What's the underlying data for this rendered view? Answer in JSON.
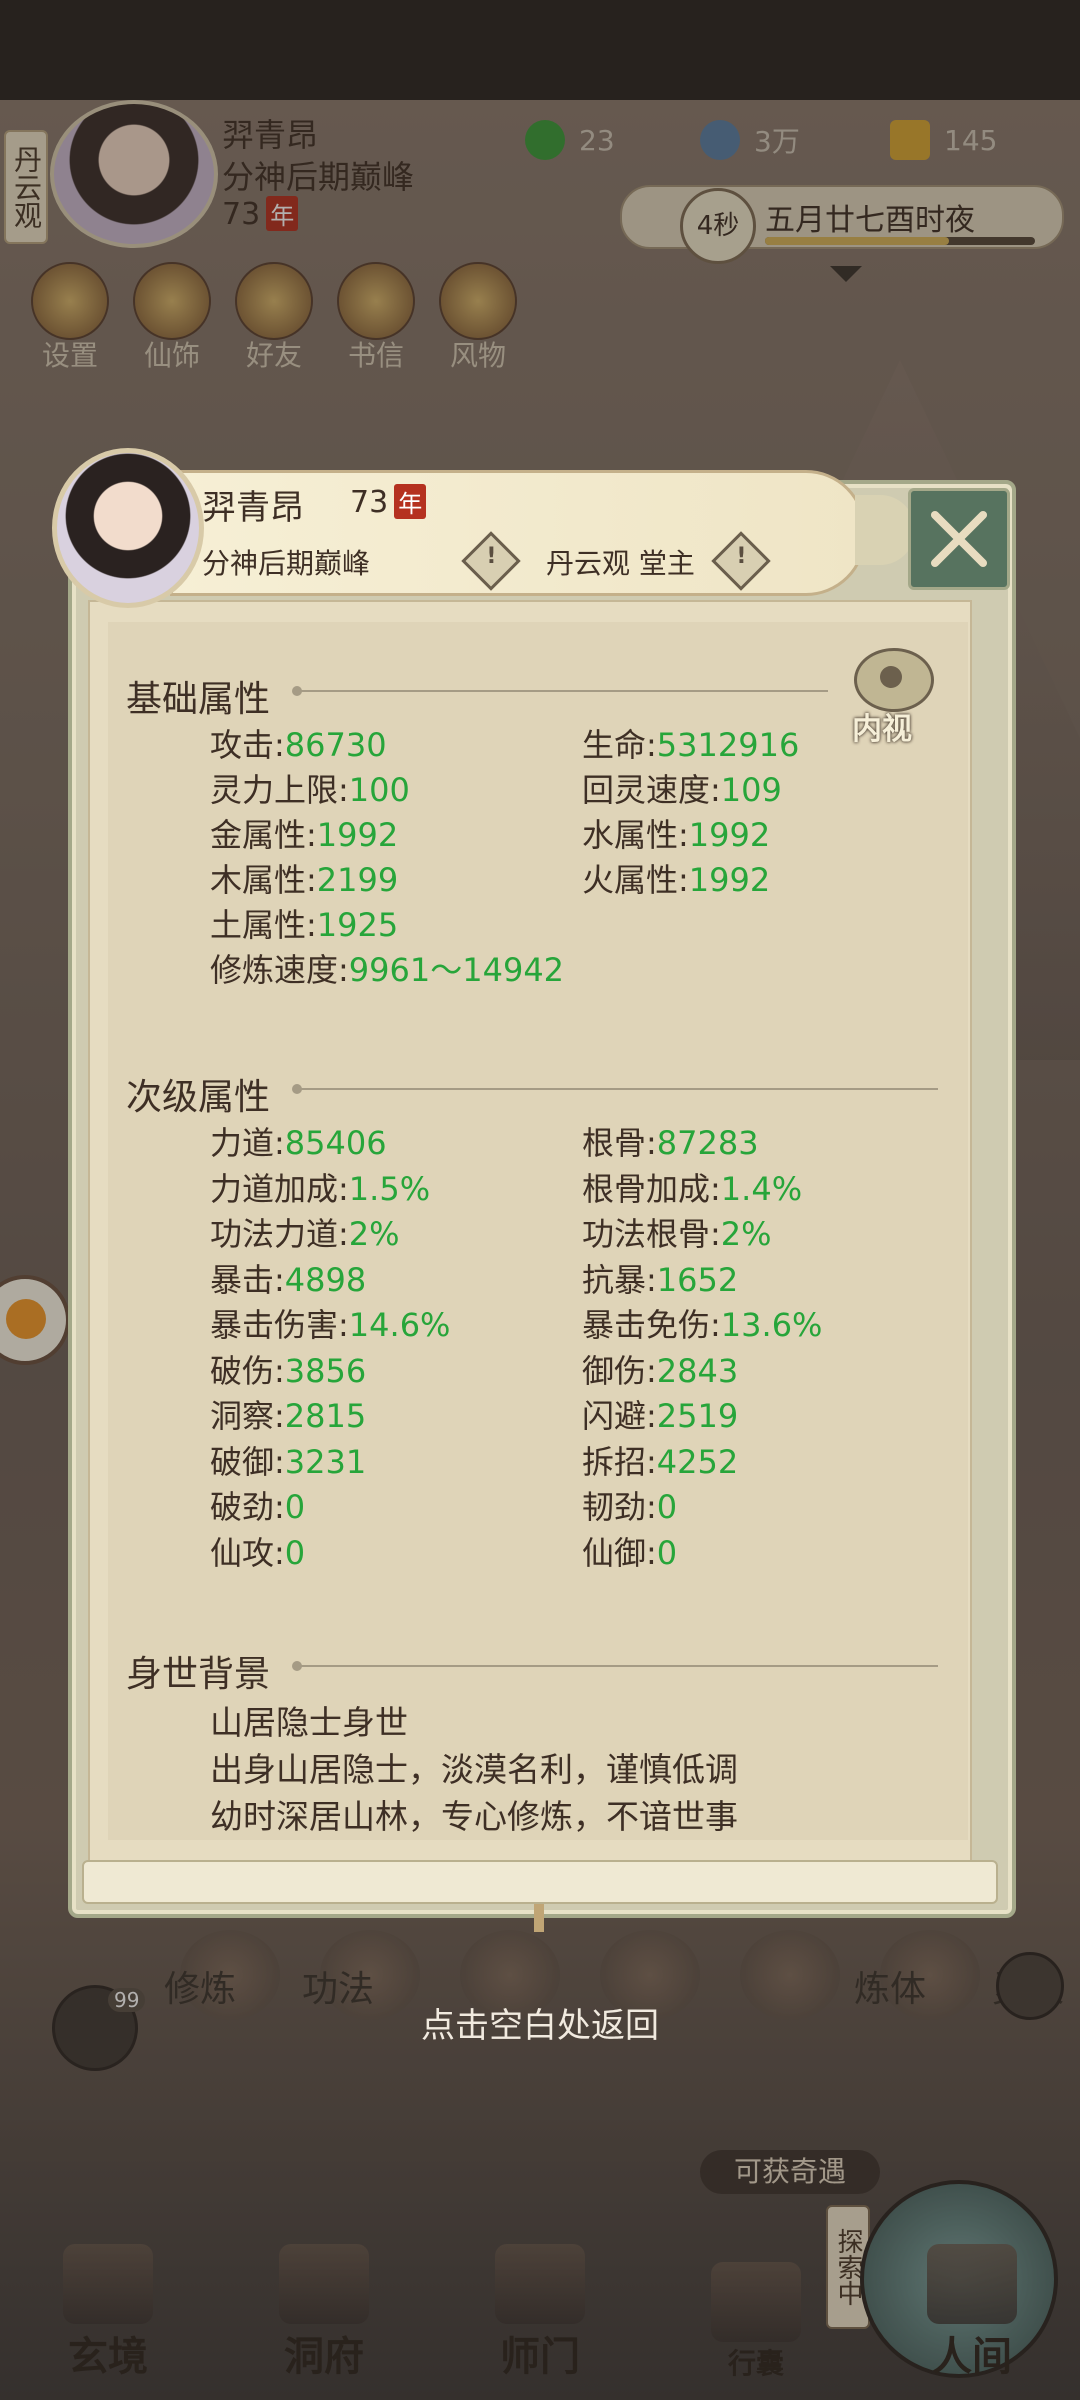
{
  "top": {
    "vertical_tag": "丹云观",
    "name": "羿青昂",
    "realm": "分神后期巅峰",
    "age": "73",
    "age_seal": "年",
    "resources": [
      {
        "icon": "leaf-icon",
        "value": "23"
      },
      {
        "icon": "coin-icon",
        "value": "3万"
      },
      {
        "icon": "gold-figure-icon",
        "value": "145"
      }
    ],
    "timer": "4秒",
    "date_text": "五月廿七酉时夜",
    "time_progress": 0.68,
    "quick": [
      "设置",
      "仙饰",
      "好友",
      "书信",
      "风物"
    ]
  },
  "panel": {
    "name": "羿青昂",
    "age": "73",
    "age_seal": "年",
    "realm": "分神后期巅峰",
    "sect": "丹云观 堂主",
    "eye_label": "内视",
    "basic_title": "基础属性",
    "basic": [
      {
        "label": "攻击",
        "value": "86730"
      },
      {
        "label": "生命",
        "value": "5312916"
      },
      {
        "label": "灵力上限",
        "value": "100"
      },
      {
        "label": "回灵速度",
        "value": "109"
      },
      {
        "label": "金属性",
        "value": "1992"
      },
      {
        "label": "水属性",
        "value": "1992"
      },
      {
        "label": "木属性",
        "value": "2199"
      },
      {
        "label": "火属性",
        "value": "1992"
      },
      {
        "label": "土属性",
        "value": "1925"
      },
      {
        "label": "修炼速度",
        "value": "9961～14942"
      }
    ],
    "secondary_title": "次级属性",
    "secondary": [
      {
        "label": "力道",
        "value": "85406"
      },
      {
        "label": "根骨",
        "value": "87283"
      },
      {
        "label": "力道加成",
        "value": "1.5%"
      },
      {
        "label": "根骨加成",
        "value": "1.4%"
      },
      {
        "label": "功法力道",
        "value": "2%"
      },
      {
        "label": "功法根骨",
        "value": "2%"
      },
      {
        "label": "暴击",
        "value": "4898"
      },
      {
        "label": "抗暴",
        "value": "1652"
      },
      {
        "label": "暴击伤害",
        "value": "14.6%"
      },
      {
        "label": "暴击免伤",
        "value": "13.6%"
      },
      {
        "label": "破伤",
        "value": "3856"
      },
      {
        "label": "御伤",
        "value": "2843"
      },
      {
        "label": "洞察",
        "value": "2815"
      },
      {
        "label": "闪避",
        "value": "2519"
      },
      {
        "label": "破御",
        "value": "3231"
      },
      {
        "label": "拆招",
        "value": "4252"
      },
      {
        "label": "破劲",
        "value": "0"
      },
      {
        "label": "韧劲",
        "value": "0"
      },
      {
        "label": "仙攻",
        "value": "0"
      },
      {
        "label": "仙御",
        "value": "0"
      }
    ],
    "background_title": "身世背景",
    "background_lines": [
      "山居隐士身世",
      "出身山居隐士，淡漠名利，谨慎低调",
      "幼时深居山林，专心修炼，不谙世事"
    ]
  },
  "underlay": {
    "skills": [
      "修炼",
      "功法",
      "",
      "",
      "",
      "炼体",
      "灵根"
    ],
    "chat_badge": "99",
    "hint": "点击空白处返回",
    "qiyu": "可获奇遇",
    "scroll_tag": "探索中",
    "nav": [
      "玄境",
      "洞府",
      "师门",
      "行囊",
      "人间"
    ]
  }
}
